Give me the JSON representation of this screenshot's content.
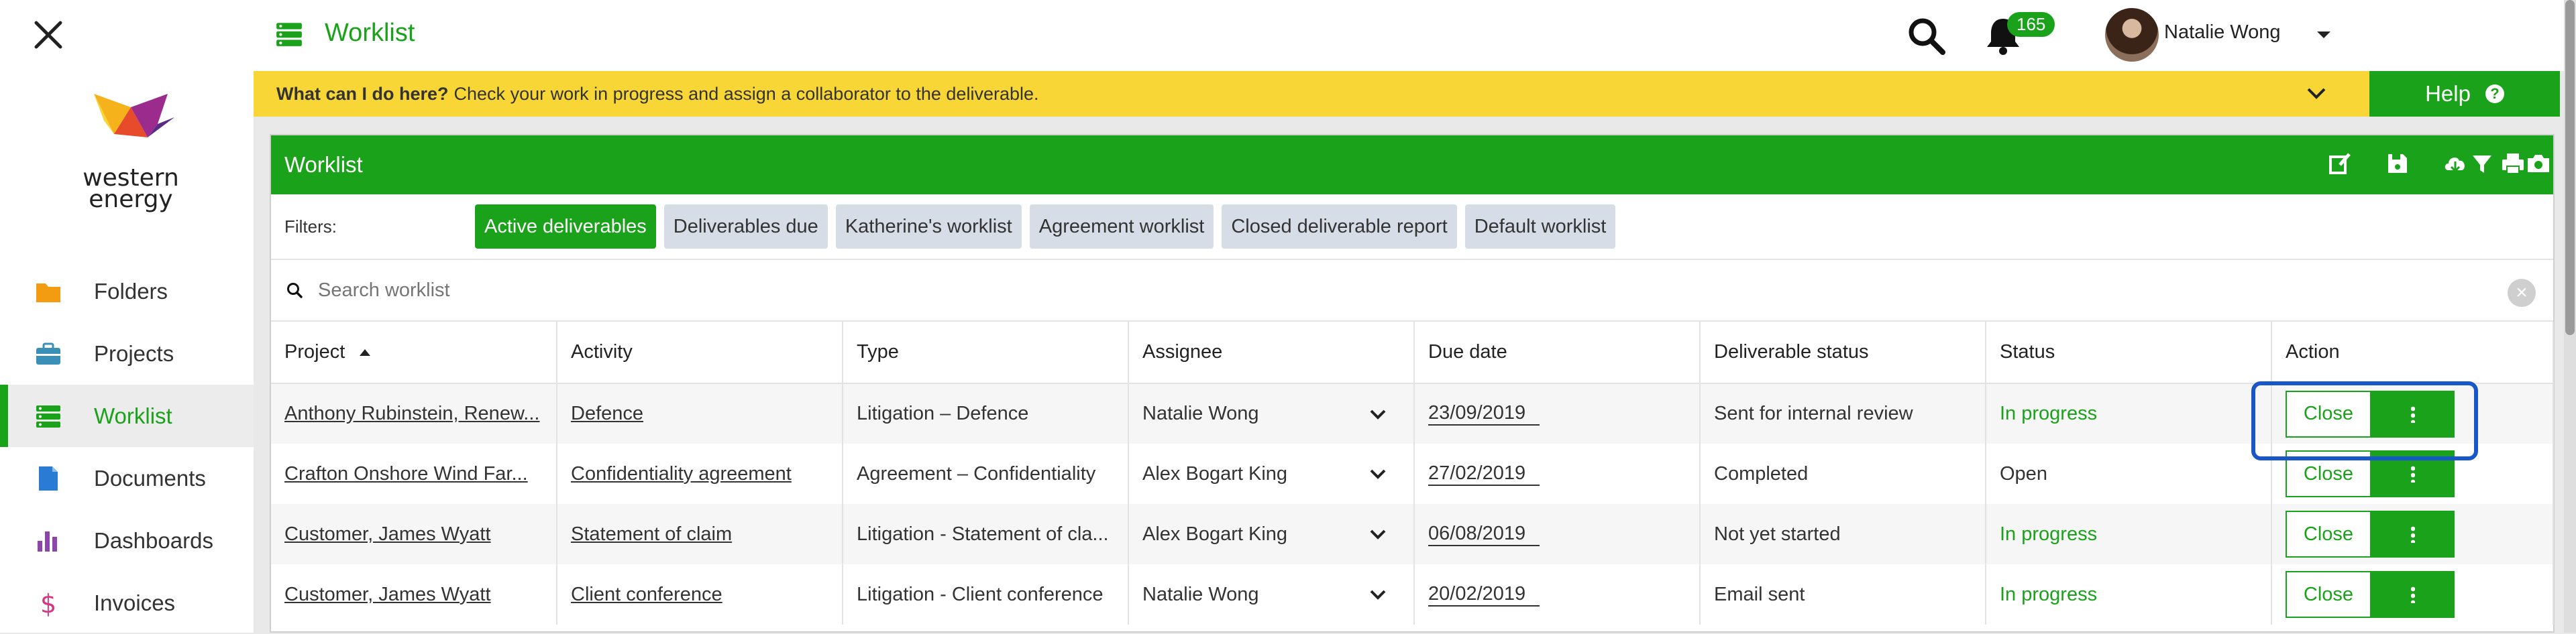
{
  "logo": {
    "line1": "western",
    "line2": "energy"
  },
  "nav": [
    {
      "label": "Folders",
      "icon": "folder-icon",
      "color": "#f39c12"
    },
    {
      "label": "Projects",
      "icon": "briefcase-icon",
      "color": "#3a8fb7"
    },
    {
      "label": "Worklist",
      "icon": "worklist-icon",
      "color": "#1aa31a",
      "active": true
    },
    {
      "label": "Documents",
      "icon": "document-icon",
      "color": "#2a7bd4"
    },
    {
      "label": "Dashboards",
      "icon": "bar-chart-icon",
      "color": "#8e44ad"
    },
    {
      "label": "Invoices",
      "icon": "dollar-icon",
      "color": "#d6357f"
    }
  ],
  "topbar": {
    "title": "Worklist",
    "notifications": "165",
    "user_name": "Natalie Wong"
  },
  "info": {
    "question": "What can I do here?",
    "text": "Check your work in progress and assign a collaborator to the deliverable.",
    "help_label": "Help"
  },
  "panel": {
    "title": "Worklist",
    "filters_label": "Filters:",
    "filters": [
      "Active deliverables",
      "Deliverables due",
      "Katherine's worklist",
      "Agreement worklist",
      "Closed deliverable report",
      "Default worklist"
    ],
    "search_placeholder": "Search worklist"
  },
  "table": {
    "headers": [
      "Project",
      "Activity",
      "Type",
      "Assignee",
      "Due date",
      "Deliverable status",
      "Status",
      "Action"
    ],
    "rows": [
      {
        "project": "Anthony Rubinstein, Renew...",
        "activity": "Defence",
        "type": "Litigation – Defence",
        "assignee": "Natalie Wong",
        "due": "23/09/2019",
        "deliverable_status": "Sent for internal review",
        "status": "In progress",
        "action": "Close"
      },
      {
        "project": "Crafton Onshore Wind Far...",
        "activity": "Confidentiality agreement",
        "type": "Agreement – Confidentiality",
        "assignee": "Alex Bogart King",
        "due": "27/02/2019",
        "deliverable_status": "Completed",
        "status": "Open",
        "action": "Close"
      },
      {
        "project": "Customer, James Wyatt",
        "activity": "Statement of claim",
        "type": "Litigation - Statement of cla...",
        "assignee": "Alex Bogart King",
        "due": "06/08/2019",
        "deliverable_status": "Not yet started",
        "status": "In progress",
        "action": "Close"
      },
      {
        "project": "Customer, James Wyatt",
        "activity": "Client conference",
        "type": "Litigation - Client conference",
        "assignee": "Natalie Wong",
        "due": "20/02/2019",
        "deliverable_status": "Email sent",
        "status": "In progress",
        "action": "Close"
      }
    ]
  },
  "colors": {
    "brand_green": "#1aa31a",
    "info_yellow": "#f8d635",
    "highlight_blue": "#1757c8"
  }
}
